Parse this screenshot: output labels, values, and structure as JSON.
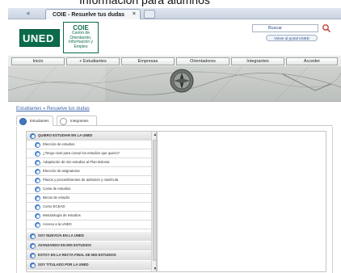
{
  "top_crop_text": "Información para alumnos",
  "browser": {
    "tab_title": "COIE - Resuelve tus dudas",
    "tab_close": "×"
  },
  "header": {
    "logo": "UNED",
    "coie_title": "COIE",
    "coie_sub_1": "Centro de",
    "coie_sub_2": "Orientación,",
    "coie_sub_3": "Información y",
    "coie_sub_4": "Empleo",
    "search_label": "Buscar",
    "portal_button": "Volver al portal UNED"
  },
  "nav": [
    "Inicio",
    "+ Estudiantes",
    "Empresas",
    "Orientadores",
    "Integrantes",
    "Acceder"
  ],
  "breadcrumb": "Estudiantes » Resuelve tus dudas",
  "subtabs": [
    {
      "label": "Estudiantes",
      "color": "#3f78c2"
    },
    {
      "label": "Integrantes",
      "color": "#ffffff"
    }
  ],
  "list": {
    "sections": [
      {
        "label": "QUIERO ESTUDIAR EN LA UNED"
      },
      {
        "label": "SOY NUEVO/A EN LA UNED"
      },
      {
        "label": "AVANZANDO EN MIS ESTUDIOS"
      },
      {
        "label": "ESTOY EN LA RECTA FINAL DE MIS ESTUDIOS"
      },
      {
        "label": "SOY TITULADO POR LA UNED"
      }
    ],
    "items": [
      "Elección de estudios",
      "¿Tengo nivel para cursar los estudios que quiero?",
      "Adaptación de mis estudios al Plan Bolonia",
      "Elección de asignaturas",
      "Plazos y procedimientos de admisión y matrícula",
      "Coste de estudios",
      "Becas de estudio",
      "Curso ECEAD",
      "Metodología de estudios",
      "Acceso a la UNED"
    ],
    "scroll_up": "▲",
    "scroll_down": "▼"
  }
}
